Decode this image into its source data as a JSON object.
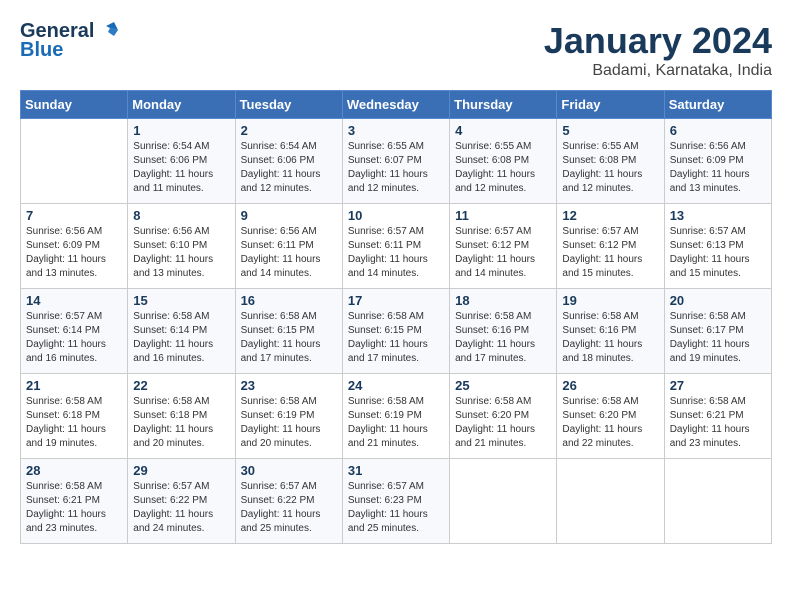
{
  "header": {
    "logo_line1": "General",
    "logo_line2": "Blue",
    "month": "January 2024",
    "location": "Badami, Karnataka, India"
  },
  "weekdays": [
    "Sunday",
    "Monday",
    "Tuesday",
    "Wednesday",
    "Thursday",
    "Friday",
    "Saturday"
  ],
  "weeks": [
    [
      {
        "day": "",
        "sunrise": "",
        "sunset": "",
        "daylight": ""
      },
      {
        "day": "1",
        "sunrise": "Sunrise: 6:54 AM",
        "sunset": "Sunset: 6:06 PM",
        "daylight": "Daylight: 11 hours and 11 minutes."
      },
      {
        "day": "2",
        "sunrise": "Sunrise: 6:54 AM",
        "sunset": "Sunset: 6:06 PM",
        "daylight": "Daylight: 11 hours and 12 minutes."
      },
      {
        "day": "3",
        "sunrise": "Sunrise: 6:55 AM",
        "sunset": "Sunset: 6:07 PM",
        "daylight": "Daylight: 11 hours and 12 minutes."
      },
      {
        "day": "4",
        "sunrise": "Sunrise: 6:55 AM",
        "sunset": "Sunset: 6:08 PM",
        "daylight": "Daylight: 11 hours and 12 minutes."
      },
      {
        "day": "5",
        "sunrise": "Sunrise: 6:55 AM",
        "sunset": "Sunset: 6:08 PM",
        "daylight": "Daylight: 11 hours and 12 minutes."
      },
      {
        "day": "6",
        "sunrise": "Sunrise: 6:56 AM",
        "sunset": "Sunset: 6:09 PM",
        "daylight": "Daylight: 11 hours and 13 minutes."
      }
    ],
    [
      {
        "day": "7",
        "sunrise": "Sunrise: 6:56 AM",
        "sunset": "Sunset: 6:09 PM",
        "daylight": "Daylight: 11 hours and 13 minutes."
      },
      {
        "day": "8",
        "sunrise": "Sunrise: 6:56 AM",
        "sunset": "Sunset: 6:10 PM",
        "daylight": "Daylight: 11 hours and 13 minutes."
      },
      {
        "day": "9",
        "sunrise": "Sunrise: 6:56 AM",
        "sunset": "Sunset: 6:11 PM",
        "daylight": "Daylight: 11 hours and 14 minutes."
      },
      {
        "day": "10",
        "sunrise": "Sunrise: 6:57 AM",
        "sunset": "Sunset: 6:11 PM",
        "daylight": "Daylight: 11 hours and 14 minutes."
      },
      {
        "day": "11",
        "sunrise": "Sunrise: 6:57 AM",
        "sunset": "Sunset: 6:12 PM",
        "daylight": "Daylight: 11 hours and 14 minutes."
      },
      {
        "day": "12",
        "sunrise": "Sunrise: 6:57 AM",
        "sunset": "Sunset: 6:12 PM",
        "daylight": "Daylight: 11 hours and 15 minutes."
      },
      {
        "day": "13",
        "sunrise": "Sunrise: 6:57 AM",
        "sunset": "Sunset: 6:13 PM",
        "daylight": "Daylight: 11 hours and 15 minutes."
      }
    ],
    [
      {
        "day": "14",
        "sunrise": "Sunrise: 6:57 AM",
        "sunset": "Sunset: 6:14 PM",
        "daylight": "Daylight: 11 hours and 16 minutes."
      },
      {
        "day": "15",
        "sunrise": "Sunrise: 6:58 AM",
        "sunset": "Sunset: 6:14 PM",
        "daylight": "Daylight: 11 hours and 16 minutes."
      },
      {
        "day": "16",
        "sunrise": "Sunrise: 6:58 AM",
        "sunset": "Sunset: 6:15 PM",
        "daylight": "Daylight: 11 hours and 17 minutes."
      },
      {
        "day": "17",
        "sunrise": "Sunrise: 6:58 AM",
        "sunset": "Sunset: 6:15 PM",
        "daylight": "Daylight: 11 hours and 17 minutes."
      },
      {
        "day": "18",
        "sunrise": "Sunrise: 6:58 AM",
        "sunset": "Sunset: 6:16 PM",
        "daylight": "Daylight: 11 hours and 17 minutes."
      },
      {
        "day": "19",
        "sunrise": "Sunrise: 6:58 AM",
        "sunset": "Sunset: 6:16 PM",
        "daylight": "Daylight: 11 hours and 18 minutes."
      },
      {
        "day": "20",
        "sunrise": "Sunrise: 6:58 AM",
        "sunset": "Sunset: 6:17 PM",
        "daylight": "Daylight: 11 hours and 19 minutes."
      }
    ],
    [
      {
        "day": "21",
        "sunrise": "Sunrise: 6:58 AM",
        "sunset": "Sunset: 6:18 PM",
        "daylight": "Daylight: 11 hours and 19 minutes."
      },
      {
        "day": "22",
        "sunrise": "Sunrise: 6:58 AM",
        "sunset": "Sunset: 6:18 PM",
        "daylight": "Daylight: 11 hours and 20 minutes."
      },
      {
        "day": "23",
        "sunrise": "Sunrise: 6:58 AM",
        "sunset": "Sunset: 6:19 PM",
        "daylight": "Daylight: 11 hours and 20 minutes."
      },
      {
        "day": "24",
        "sunrise": "Sunrise: 6:58 AM",
        "sunset": "Sunset: 6:19 PM",
        "daylight": "Daylight: 11 hours and 21 minutes."
      },
      {
        "day": "25",
        "sunrise": "Sunrise: 6:58 AM",
        "sunset": "Sunset: 6:20 PM",
        "daylight": "Daylight: 11 hours and 21 minutes."
      },
      {
        "day": "26",
        "sunrise": "Sunrise: 6:58 AM",
        "sunset": "Sunset: 6:20 PM",
        "daylight": "Daylight: 11 hours and 22 minutes."
      },
      {
        "day": "27",
        "sunrise": "Sunrise: 6:58 AM",
        "sunset": "Sunset: 6:21 PM",
        "daylight": "Daylight: 11 hours and 23 minutes."
      }
    ],
    [
      {
        "day": "28",
        "sunrise": "Sunrise: 6:58 AM",
        "sunset": "Sunset: 6:21 PM",
        "daylight": "Daylight: 11 hours and 23 minutes."
      },
      {
        "day": "29",
        "sunrise": "Sunrise: 6:57 AM",
        "sunset": "Sunset: 6:22 PM",
        "daylight": "Daylight: 11 hours and 24 minutes."
      },
      {
        "day": "30",
        "sunrise": "Sunrise: 6:57 AM",
        "sunset": "Sunset: 6:22 PM",
        "daylight": "Daylight: 11 hours and 25 minutes."
      },
      {
        "day": "31",
        "sunrise": "Sunrise: 6:57 AM",
        "sunset": "Sunset: 6:23 PM",
        "daylight": "Daylight: 11 hours and 25 minutes."
      },
      {
        "day": "",
        "sunrise": "",
        "sunset": "",
        "daylight": ""
      },
      {
        "day": "",
        "sunrise": "",
        "sunset": "",
        "daylight": ""
      },
      {
        "day": "",
        "sunrise": "",
        "sunset": "",
        "daylight": ""
      }
    ]
  ]
}
